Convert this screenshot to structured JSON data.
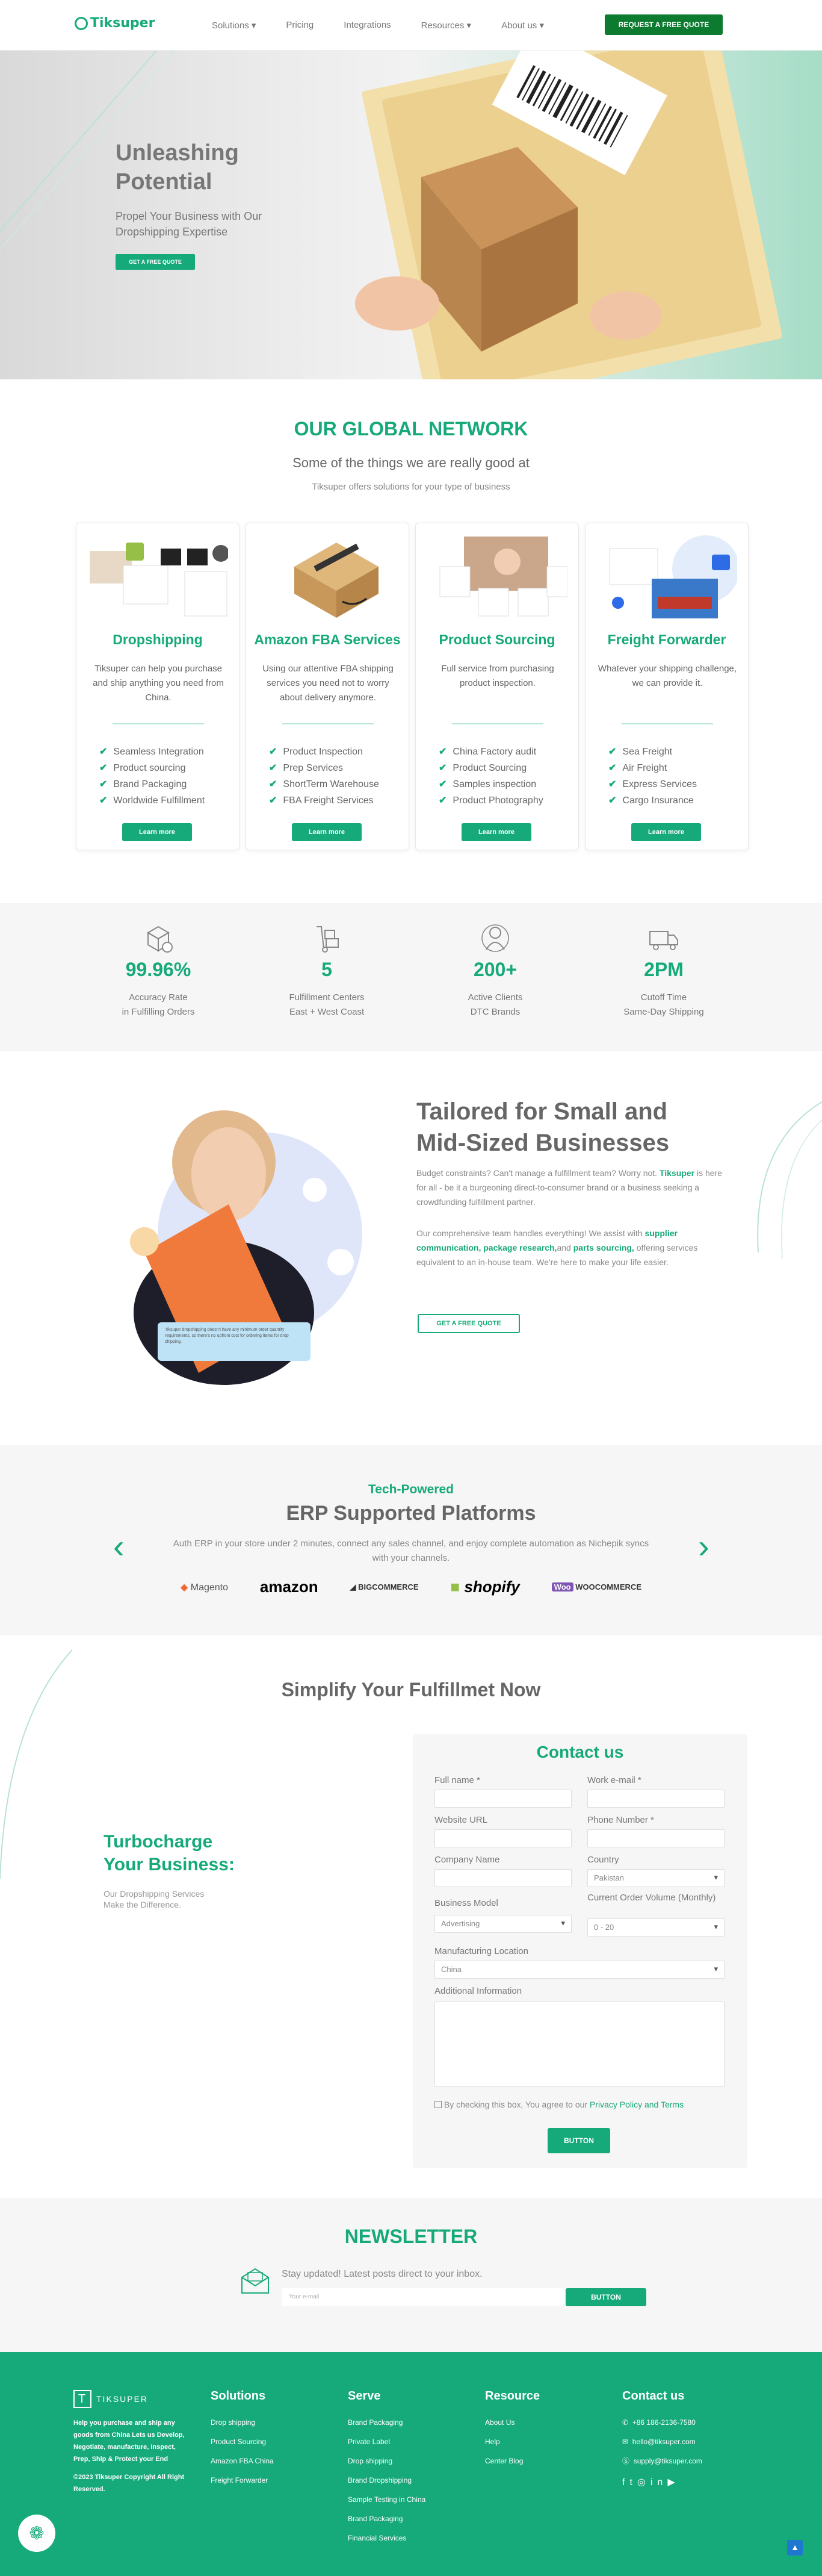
{
  "header": {
    "logo": "Tiksuper",
    "nav": [
      "Solutions",
      "Pricing",
      "Integrations",
      "Resources",
      "About us"
    ],
    "nav_dropdown": [
      true,
      false,
      false,
      true,
      true
    ],
    "cta": "REQUEST A FREE QUOTE"
  },
  "hero": {
    "title_line1": "Unleashing",
    "title_line2": "Potential",
    "subtitle": "Propel Your Business with Our Dropshipping Expertise",
    "button": "GET A FREE QUOTE"
  },
  "network": {
    "title": "OUR GLOBAL NETWORK",
    "subtitle": "Some of the things we are really good at",
    "tagline": "Tiksuper offers solutions for your type of business",
    "cards": [
      {
        "title": "Dropshipping",
        "text": "Tiksuper can help you purchase and ship anything you need from China.",
        "items": [
          "Seamless Integration",
          "Product sourcing",
          "Brand Packaging",
          "Worldwide Fulfillment"
        ],
        "button": "Learn more"
      },
      {
        "title": "Amazon FBA Services",
        "text": "Using our attentive FBA shipping services you need not to worry about delivery anymore.",
        "items": [
          "Product Inspection",
          "Prep Services",
          "ShortTerm Warehouse",
          "FBA Freight Services"
        ],
        "button": "Learn more"
      },
      {
        "title": "Product Sourcing",
        "text": "Full service from purchasing product inspection.",
        "items": [
          "China Factory audit",
          "Product Sourcing",
          "Samples inspection",
          "Product Photography"
        ],
        "button": "Learn more"
      },
      {
        "title": "Freight Forwarder",
        "text": "Whatever your shipping challenge, we can provide it.",
        "items": [
          "Sea Freight",
          "Air Freight",
          "Express Services",
          "Cargo Insurance"
        ],
        "button": "Learn more"
      }
    ]
  },
  "stats": [
    {
      "value": "99.96%",
      "label1": "Accuracy Rate",
      "label2": "in Fulfilling Orders",
      "icon": "box-check-icon"
    },
    {
      "value": "5",
      "label1": "Fulfillment Centers",
      "label2": "East + West Coast",
      "icon": "hand-truck-icon"
    },
    {
      "value": "200+",
      "label1": "Active Clients",
      "label2": "DTC Brands",
      "icon": "users-icon"
    },
    {
      "value": "2PM",
      "label1": "Cutoff Time",
      "label2": "Same-Day Shipping",
      "icon": "delivery-truck-icon"
    }
  ],
  "tailored": {
    "title_line1": "Tailored for Small and",
    "title_line2": "Mid-Sized Businesses",
    "p1_a": "Budget constraints? Can't manage a fulfillment team? Worry not.",
    "p1_brand": "Tiksuper",
    "p1_b": "is here for all - be it a burgeoning direct-to-consumer brand or a business seeking a crowdfunding fulfillment partner.",
    "p2_a": "Our comprehensive team handles everything! We assist with",
    "p2_b1": "supplier communication, package research,",
    "p2_c": "and",
    "p2_b2": "parts sourcing,",
    "p2_d": "offering services equivalent to an in-house team. We're here to make your life easier.",
    "button": "GET A FREE QUOTE",
    "chat": "Tiksuper dropshipping doesn't have any minimum order quantity requirements, so there's no upfront cost for ordering items for drop shipping."
  },
  "erp": {
    "kicker": "Tech-Powered",
    "title": "ERP Supported Platforms",
    "text": "Auth ERP in your store under 2 minutes, connect any sales channel, and enjoy complete automation as Nichepik syncs with your channels.",
    "logos": [
      "Magento",
      "amazon",
      "BIGCOMMERCE",
      "shopify",
      "WOOCOMMERCE"
    ]
  },
  "simplify": {
    "title": "Simplify Your Fulfillmet Now",
    "side_title1": "Turbocharge",
    "side_title2": "Your Business:",
    "side_text1": "Our Dropshipping Services",
    "side_text2": "Make the Difference."
  },
  "form": {
    "title": "Contact us",
    "full_name": "Full name *",
    "work_email": "Work e-mail *",
    "website": "Website URL",
    "phone": "Phone Number *",
    "company": "Company Name",
    "country": "Country",
    "country_value": "Pakistan",
    "business_model": "Business Model",
    "business_value": "Advertising",
    "volume": "Current Order Volume (Monthly)",
    "volume_value": "0 - 20",
    "mfg": "Manufacturing Location",
    "mfg_value": "China",
    "additional": "Additional Information",
    "consent_a": "By checking this box, You agree to our",
    "consent_link": "Privacy Policy and Terms",
    "button": "BUTTON"
  },
  "newsletter": {
    "title": "NEWSLETTER",
    "text": "Stay updated! Latest posts direct to your inbox.",
    "placeholder": "Your e-mail",
    "button": "BUTTON"
  },
  "footer": {
    "brand": "TIKSUPER",
    "about": "Help you purchase and ship any goods from China Lets us Develop, Negotiate, manufacture, Inspect, Prep, Ship & Protect your End",
    "copyright": "©2023 Tiksuper Copyright All Right Reserved.",
    "solutions": {
      "title": "Solutions",
      "items": [
        "Drop shipping",
        "Product Sourcing",
        "Amazon FBA China",
        "Freight Forwarder"
      ]
    },
    "serve": {
      "title": "Serve",
      "items": [
        "Brand Packaging",
        "Private Label",
        "Drop shipping",
        "Brand Dropshipping",
        "Sample Testing in China",
        "Brand Packaging",
        "Financial Services"
      ]
    },
    "resource": {
      "title": "Resource",
      "items": [
        "About Us",
        "Help",
        "Center Blog"
      ]
    },
    "contact": {
      "title": "Contact us",
      "phone": "+86 186-2136-7580",
      "email": "hello@tiksuper.com",
      "skype": "supply@tiksuper.com"
    }
  },
  "colors": {
    "accent": "#16a97a",
    "cta_dark": "#0c7a2f"
  }
}
